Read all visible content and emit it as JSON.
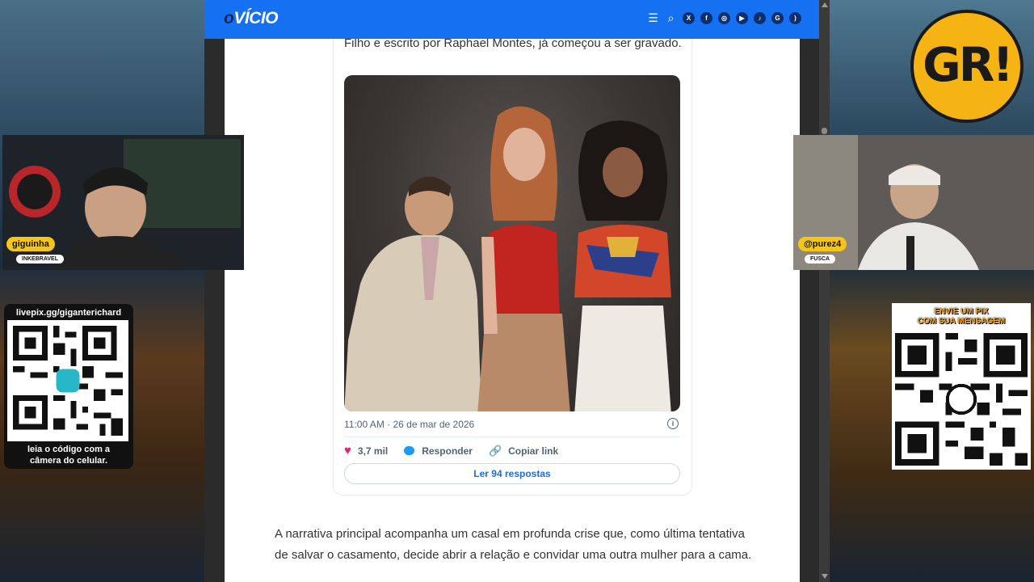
{
  "site": {
    "logo_o": "o",
    "logo_rest": "VÍCIO",
    "header_icons": [
      "menu-icon",
      "search-icon",
      "x-icon",
      "facebook-icon",
      "instagram-icon",
      "youtube-icon",
      "tiktok-icon",
      "google-news-icon",
      "rss-icon"
    ],
    "brand_color": "#1570f2"
  },
  "article": {
    "intro_text": "Filho e escrito por Raphael Montes, já começou a ser gravado.",
    "paragraph": "A narrativa principal acompanha um casal em profunda crise que, como última tentativa de salvar o casamento, decide abrir a relação e convidar uma outra mulher para a cama."
  },
  "tweet": {
    "timestamp": "11:00 AM · 26 de mar de 2026",
    "likes": "3,7 mil",
    "reply_label": "Responder",
    "copy_link_label": "Copiar link",
    "read_replies_label": "Ler 94 respostas"
  },
  "overlay": {
    "left_cam": {
      "name": "giguinha",
      "sub": "INKEBRAVEL"
    },
    "right_cam": {
      "name": "@purez4",
      "sub": "FUSCA"
    },
    "left_qr": {
      "title": "livepix.gg/giganterichard",
      "caption_line1": "leia o código com a",
      "caption_line2": "câmera do celular."
    },
    "right_qr": {
      "title_line1": "ENVIE UM PIX",
      "title_line2": "COM SUA MENSAGEM"
    },
    "logo_text": "GR!"
  }
}
